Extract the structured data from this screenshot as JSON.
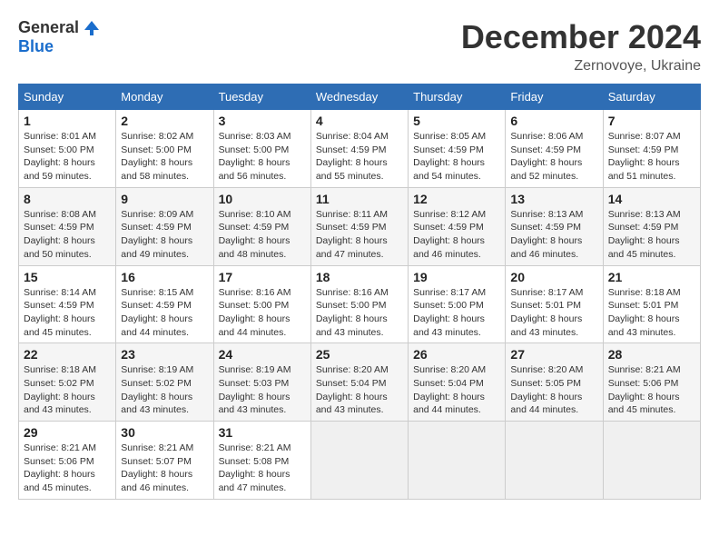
{
  "logo": {
    "general": "General",
    "blue": "Blue"
  },
  "title": {
    "month_year": "December 2024",
    "location": "Zernovoye, Ukraine"
  },
  "headers": [
    "Sunday",
    "Monday",
    "Tuesday",
    "Wednesday",
    "Thursday",
    "Friday",
    "Saturday"
  ],
  "weeks": [
    [
      {
        "day": "1",
        "sunrise": "8:01 AM",
        "sunset": "5:00 PM",
        "daylight": "8 hours and 59 minutes."
      },
      {
        "day": "2",
        "sunrise": "8:02 AM",
        "sunset": "5:00 PM",
        "daylight": "8 hours and 58 minutes."
      },
      {
        "day": "3",
        "sunrise": "8:03 AM",
        "sunset": "5:00 PM",
        "daylight": "8 hours and 56 minutes."
      },
      {
        "day": "4",
        "sunrise": "8:04 AM",
        "sunset": "4:59 PM",
        "daylight": "8 hours and 55 minutes."
      },
      {
        "day": "5",
        "sunrise": "8:05 AM",
        "sunset": "4:59 PM",
        "daylight": "8 hours and 54 minutes."
      },
      {
        "day": "6",
        "sunrise": "8:06 AM",
        "sunset": "4:59 PM",
        "daylight": "8 hours and 52 minutes."
      },
      {
        "day": "7",
        "sunrise": "8:07 AM",
        "sunset": "4:59 PM",
        "daylight": "8 hours and 51 minutes."
      }
    ],
    [
      {
        "day": "8",
        "sunrise": "8:08 AM",
        "sunset": "4:59 PM",
        "daylight": "8 hours and 50 minutes."
      },
      {
        "day": "9",
        "sunrise": "8:09 AM",
        "sunset": "4:59 PM",
        "daylight": "8 hours and 49 minutes."
      },
      {
        "day": "10",
        "sunrise": "8:10 AM",
        "sunset": "4:59 PM",
        "daylight": "8 hours and 48 minutes."
      },
      {
        "day": "11",
        "sunrise": "8:11 AM",
        "sunset": "4:59 PM",
        "daylight": "8 hours and 47 minutes."
      },
      {
        "day": "12",
        "sunrise": "8:12 AM",
        "sunset": "4:59 PM",
        "daylight": "8 hours and 46 minutes."
      },
      {
        "day": "13",
        "sunrise": "8:13 AM",
        "sunset": "4:59 PM",
        "daylight": "8 hours and 46 minutes."
      },
      {
        "day": "14",
        "sunrise": "8:13 AM",
        "sunset": "4:59 PM",
        "daylight": "8 hours and 45 minutes."
      }
    ],
    [
      {
        "day": "15",
        "sunrise": "8:14 AM",
        "sunset": "4:59 PM",
        "daylight": "8 hours and 45 minutes."
      },
      {
        "day": "16",
        "sunrise": "8:15 AM",
        "sunset": "4:59 PM",
        "daylight": "8 hours and 44 minutes."
      },
      {
        "day": "17",
        "sunrise": "8:16 AM",
        "sunset": "5:00 PM",
        "daylight": "8 hours and 44 minutes."
      },
      {
        "day": "18",
        "sunrise": "8:16 AM",
        "sunset": "5:00 PM",
        "daylight": "8 hours and 43 minutes."
      },
      {
        "day": "19",
        "sunrise": "8:17 AM",
        "sunset": "5:00 PM",
        "daylight": "8 hours and 43 minutes."
      },
      {
        "day": "20",
        "sunrise": "8:17 AM",
        "sunset": "5:01 PM",
        "daylight": "8 hours and 43 minutes."
      },
      {
        "day": "21",
        "sunrise": "8:18 AM",
        "sunset": "5:01 PM",
        "daylight": "8 hours and 43 minutes."
      }
    ],
    [
      {
        "day": "22",
        "sunrise": "8:18 AM",
        "sunset": "5:02 PM",
        "daylight": "8 hours and 43 minutes."
      },
      {
        "day": "23",
        "sunrise": "8:19 AM",
        "sunset": "5:02 PM",
        "daylight": "8 hours and 43 minutes."
      },
      {
        "day": "24",
        "sunrise": "8:19 AM",
        "sunset": "5:03 PM",
        "daylight": "8 hours and 43 minutes."
      },
      {
        "day": "25",
        "sunrise": "8:20 AM",
        "sunset": "5:04 PM",
        "daylight": "8 hours and 43 minutes."
      },
      {
        "day": "26",
        "sunrise": "8:20 AM",
        "sunset": "5:04 PM",
        "daylight": "8 hours and 44 minutes."
      },
      {
        "day": "27",
        "sunrise": "8:20 AM",
        "sunset": "5:05 PM",
        "daylight": "8 hours and 44 minutes."
      },
      {
        "day": "28",
        "sunrise": "8:21 AM",
        "sunset": "5:06 PM",
        "daylight": "8 hours and 45 minutes."
      }
    ],
    [
      {
        "day": "29",
        "sunrise": "8:21 AM",
        "sunset": "5:06 PM",
        "daylight": "8 hours and 45 minutes."
      },
      {
        "day": "30",
        "sunrise": "8:21 AM",
        "sunset": "5:07 PM",
        "daylight": "8 hours and 46 minutes."
      },
      {
        "day": "31",
        "sunrise": "8:21 AM",
        "sunset": "5:08 PM",
        "daylight": "8 hours and 47 minutes."
      },
      null,
      null,
      null,
      null
    ]
  ]
}
